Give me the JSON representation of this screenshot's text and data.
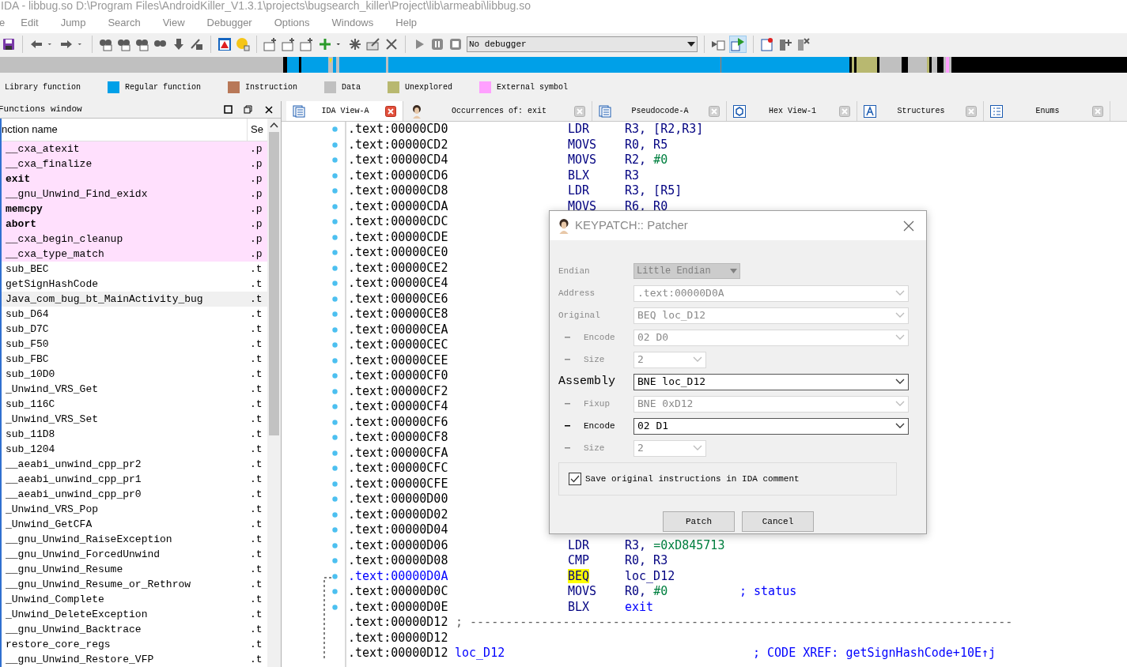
{
  "window": {
    "title": "IDA - libbug.so D:\\Program Files\\AndroidKiller_V1.3.1\\projects\\bugsearch_killer\\Project\\lib\\armeabi\\libbug.so"
  },
  "menu": [
    "e",
    "Edit",
    "Jump",
    "Search",
    "View",
    "Debugger",
    "Options",
    "Windows",
    "Help"
  ],
  "toolbar": {
    "debugger_select": "No debugger"
  },
  "legend": [
    {
      "label": "Library function"
    },
    {
      "label": "Regular function",
      "color": "#00a0e8"
    },
    {
      "label": "Instruction",
      "color": "#b87858"
    },
    {
      "label": "Data",
      "color": "#c0c0c0"
    },
    {
      "label": "Unexplored",
      "color": "#b8b870"
    },
    {
      "label": "External symbol",
      "color": "#ffa0ff"
    }
  ],
  "functions_window": {
    "title": "Functions window",
    "columns": [
      "nction name",
      "Se"
    ],
    "rows": [
      {
        "name": "__cxa_atexit",
        "segment": ".p",
        "kind": "external",
        "bold": false,
        "selected": false
      },
      {
        "name": "__cxa_finalize",
        "segment": ".p",
        "kind": "external",
        "bold": false,
        "selected": false
      },
      {
        "name": "exit",
        "segment": ".p",
        "kind": "external",
        "bold": true,
        "selected": false
      },
      {
        "name": "__gnu_Unwind_Find_exidx",
        "segment": ".p",
        "kind": "external",
        "bold": false,
        "selected": false
      },
      {
        "name": "memcpy",
        "segment": ".p",
        "kind": "external",
        "bold": true,
        "selected": false
      },
      {
        "name": "abort",
        "segment": ".p",
        "kind": "external",
        "bold": true,
        "selected": false
      },
      {
        "name": "__cxa_begin_cleanup",
        "segment": ".p",
        "kind": "external",
        "bold": false,
        "selected": false
      },
      {
        "name": "__cxa_type_match",
        "segment": ".p",
        "kind": "external",
        "bold": false,
        "selected": false
      },
      {
        "name": "sub_BEC",
        "segment": ".t",
        "kind": "regular",
        "bold": false,
        "selected": false
      },
      {
        "name": "getSignHashCode",
        "segment": ".t",
        "kind": "regular",
        "bold": false,
        "selected": false
      },
      {
        "name": "Java_com_bug_bt_MainActivity_bug",
        "segment": ".t",
        "kind": "regular",
        "bold": false,
        "selected": true
      },
      {
        "name": "sub_D64",
        "segment": ".t",
        "kind": "regular",
        "bold": false,
        "selected": false
      },
      {
        "name": "sub_D7C",
        "segment": ".t",
        "kind": "regular",
        "bold": false,
        "selected": false
      },
      {
        "name": "sub_F50",
        "segment": ".t",
        "kind": "regular",
        "bold": false,
        "selected": false
      },
      {
        "name": "sub_FBC",
        "segment": ".t",
        "kind": "regular",
        "bold": false,
        "selected": false
      },
      {
        "name": "sub_10D0",
        "segment": ".t",
        "kind": "regular",
        "bold": false,
        "selected": false
      },
      {
        "name": "_Unwind_VRS_Get",
        "segment": ".t",
        "kind": "regular",
        "bold": false,
        "selected": false
      },
      {
        "name": "sub_116C",
        "segment": ".t",
        "kind": "regular",
        "bold": false,
        "selected": false
      },
      {
        "name": "_Unwind_VRS_Set",
        "segment": ".t",
        "kind": "regular",
        "bold": false,
        "selected": false
      },
      {
        "name": "sub_11D8",
        "segment": ".t",
        "kind": "regular",
        "bold": false,
        "selected": false
      },
      {
        "name": "sub_1204",
        "segment": ".t",
        "kind": "regular",
        "bold": false,
        "selected": false
      },
      {
        "name": "__aeabi_unwind_cpp_pr2",
        "segment": ".t",
        "kind": "regular",
        "bold": false,
        "selected": false
      },
      {
        "name": "__aeabi_unwind_cpp_pr1",
        "segment": ".t",
        "kind": "regular",
        "bold": false,
        "selected": false
      },
      {
        "name": "__aeabi_unwind_cpp_pr0",
        "segment": ".t",
        "kind": "regular",
        "bold": false,
        "selected": false
      },
      {
        "name": "_Unwind_VRS_Pop",
        "segment": ".t",
        "kind": "regular",
        "bold": false,
        "selected": false
      },
      {
        "name": "_Unwind_GetCFA",
        "segment": ".t",
        "kind": "regular",
        "bold": false,
        "selected": false
      },
      {
        "name": "__gnu_Unwind_RaiseException",
        "segment": ".t",
        "kind": "regular",
        "bold": false,
        "selected": false
      },
      {
        "name": "__gnu_Unwind_ForcedUnwind",
        "segment": ".t",
        "kind": "regular",
        "bold": false,
        "selected": false
      },
      {
        "name": "__gnu_Unwind_Resume",
        "segment": ".t",
        "kind": "regular",
        "bold": false,
        "selected": false
      },
      {
        "name": "__gnu_Unwind_Resume_or_Rethrow",
        "segment": ".t",
        "kind": "regular",
        "bold": false,
        "selected": false
      },
      {
        "name": "_Unwind_Complete",
        "segment": ".t",
        "kind": "regular",
        "bold": false,
        "selected": false
      },
      {
        "name": "_Unwind_DeleteException",
        "segment": ".t",
        "kind": "regular",
        "bold": false,
        "selected": false
      },
      {
        "name": "__gnu_Unwind_Backtrace",
        "segment": ".t",
        "kind": "regular",
        "bold": false,
        "selected": false
      },
      {
        "name": "restore_core_regs",
        "segment": ".t",
        "kind": "regular",
        "bold": false,
        "selected": false
      },
      {
        "name": "__gnu_Unwind_Restore_VFP",
        "segment": ".t",
        "kind": "regular",
        "bold": false,
        "selected": false
      }
    ]
  },
  "tabs": [
    {
      "label": "IDA View-A",
      "kind": "listing",
      "selected": true
    },
    {
      "label": "Occurrences of: exit",
      "kind": "occurrences",
      "selected": false
    },
    {
      "label": "Pseudocode-A",
      "kind": "listing",
      "selected": false
    },
    {
      "label": "Hex View-1",
      "kind": "hex",
      "selected": false
    },
    {
      "label": "Structures",
      "kind": "struct",
      "selected": false
    },
    {
      "label": "Enums",
      "kind": "enum",
      "selected": false
    }
  ],
  "listing": [
    {
      "kind": "insn",
      "address": ".text:00000CD0",
      "mnemonic": "LDR",
      "operands": [
        {
          "text": "R3, [R2,R3]",
          "kind": "reg"
        }
      ]
    },
    {
      "kind": "insn",
      "address": ".text:00000CD2",
      "mnemonic": "MOVS",
      "operands": [
        {
          "text": "R0, R5",
          "kind": "reg"
        }
      ]
    },
    {
      "kind": "insn",
      "address": ".text:00000CD4",
      "mnemonic": "MOVS",
      "operands": [
        {
          "text": "R2, ",
          "kind": "reg"
        },
        {
          "text": "#0",
          "kind": "imm"
        }
      ]
    },
    {
      "kind": "insn",
      "address": ".text:00000CD6",
      "mnemonic": "BLX",
      "operands": [
        {
          "text": "R3",
          "kind": "reg"
        }
      ]
    },
    {
      "kind": "insn",
      "address": ".text:00000CD8",
      "mnemonic": "LDR",
      "operands": [
        {
          "text": "R3, [R5]",
          "kind": "reg"
        }
      ]
    },
    {
      "kind": "insn",
      "address": ".text:00000CDA",
      "mnemonic": "MOVS",
      "operands": [
        {
          "text": "R6, R0",
          "kind": "reg"
        }
      ]
    },
    {
      "kind": "insn",
      "address": ".text:00000CDC"
    },
    {
      "kind": "insn",
      "address": ".text:00000CDE"
    },
    {
      "kind": "insn",
      "address": ".text:00000CE0"
    },
    {
      "kind": "insn",
      "address": ".text:00000CE2"
    },
    {
      "kind": "insn",
      "address": ".text:00000CE4"
    },
    {
      "kind": "insn",
      "address": ".text:00000CE6"
    },
    {
      "kind": "insn",
      "address": ".text:00000CE8"
    },
    {
      "kind": "insn",
      "address": ".text:00000CEA"
    },
    {
      "kind": "insn",
      "address": ".text:00000CEC"
    },
    {
      "kind": "insn",
      "address": ".text:00000CEE"
    },
    {
      "kind": "insn",
      "address": ".text:00000CF0"
    },
    {
      "kind": "insn",
      "address": ".text:00000CF2"
    },
    {
      "kind": "insn",
      "address": ".text:00000CF4"
    },
    {
      "kind": "insn",
      "address": ".text:00000CF6"
    },
    {
      "kind": "insn",
      "address": ".text:00000CF8"
    },
    {
      "kind": "insn",
      "address": ".text:00000CFA"
    },
    {
      "kind": "insn",
      "address": ".text:00000CFC"
    },
    {
      "kind": "insn",
      "address": ".text:00000CFE"
    },
    {
      "kind": "insn",
      "address": ".text:00000D00"
    },
    {
      "kind": "insn",
      "address": ".text:00000D02"
    },
    {
      "kind": "insn",
      "address": ".text:00000D04"
    },
    {
      "kind": "insn",
      "address": ".text:00000D06",
      "mnemonic": "LDR",
      "operands": [
        {
          "text": "R3, ",
          "kind": "reg"
        },
        {
          "text": "=0xD845713",
          "kind": "imm"
        }
      ]
    },
    {
      "kind": "insn",
      "address": ".text:00000D08",
      "mnemonic": "CMP",
      "operands": [
        {
          "text": "R0, R3",
          "kind": "reg"
        }
      ]
    },
    {
      "kind": "insn",
      "address": ".text:00000D0A",
      "mnemonic": "BEQ",
      "current": true,
      "operands": [
        {
          "text": "loc_D12",
          "kind": "reg"
        }
      ]
    },
    {
      "kind": "insn",
      "address": ".text:00000D0C",
      "mnemonic": "MOVS",
      "operands": [
        {
          "text": "R0, ",
          "kind": "reg"
        },
        {
          "text": "#0",
          "kind": "imm"
        }
      ],
      "comment": "; status"
    },
    {
      "kind": "insn",
      "address": ".text:00000D0E",
      "mnemonic": "BLX",
      "operands": [
        {
          "text": "exit",
          "kind": "name"
        }
      ]
    },
    {
      "kind": "separator",
      "address": ".text:00000D12",
      "text": "; ----------------------------------------------------------------------------"
    },
    {
      "kind": "blank",
      "address": ".text:00000D12"
    },
    {
      "kind": "label",
      "address": ".text:00000D12",
      "label": "loc_D12",
      "comment": "; CODE XREF: getSignHashCode+10E↑j"
    }
  ],
  "dialog": {
    "title": "KEYPATCH:: Patcher",
    "fields": [
      {
        "label": "Endian",
        "sub": false,
        "kind": "static",
        "value": "Little Endian",
        "disabled": true,
        "bold": false
      },
      {
        "label": "Address",
        "sub": false,
        "kind": "wide",
        "value": ".text:00000D0A",
        "disabled": true,
        "bold": false
      },
      {
        "label": "Original",
        "sub": false,
        "kind": "wide",
        "value": "BEQ loc_D12",
        "disabled": true,
        "bold": false
      },
      {
        "label": "Encode",
        "sub": true,
        "kind": "wide",
        "value": "02 D0",
        "disabled": true,
        "bold": false
      },
      {
        "label": "Size",
        "sub": true,
        "kind": "short",
        "value": "2",
        "disabled": true,
        "bold": false
      },
      {
        "label": "Assembly",
        "sub": false,
        "kind": "wide",
        "value": "BNE loc_D12",
        "disabled": false,
        "bold": true
      },
      {
        "label": "Fixup",
        "sub": true,
        "kind": "wide",
        "value": "BNE 0xD12",
        "disabled": true,
        "bold": false
      },
      {
        "label": "Encode",
        "sub": true,
        "kind": "wide",
        "value": "02 D1",
        "disabled": false,
        "bold": false
      },
      {
        "label": "Size",
        "sub": true,
        "kind": "short",
        "value": "2",
        "disabled": true,
        "bold": false
      }
    ],
    "checkbox": {
      "label": "Save original instructions in IDA comment",
      "checked": true
    },
    "buttons": [
      "Patch",
      "Cancel"
    ]
  }
}
